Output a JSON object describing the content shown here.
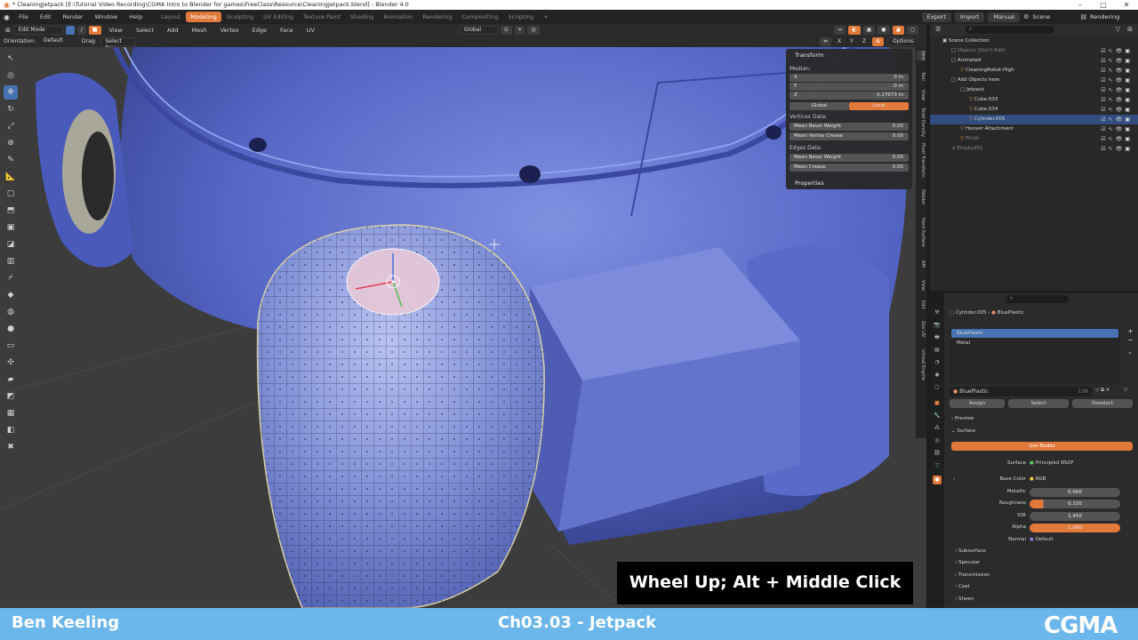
{
  "window": {
    "title": "* CleaningJetpack [E:\\Tutorial Video Recording\\CGMA Intro to Blender for games\\FreeClass\\Resource\\CleaningJetpack.blend] - Blender 4.0"
  },
  "menu": {
    "items": [
      "File",
      "Edit",
      "Render",
      "Window",
      "Help"
    ]
  },
  "workspaces": {
    "tabs": [
      "Layout",
      "Modeling",
      "Sculpting",
      "UV Editing",
      "Texture Paint",
      "Shading",
      "Animation",
      "Rendering",
      "Compositing",
      "Scripting"
    ],
    "active": "Modeling",
    "add": "+"
  },
  "topright": {
    "export": "Export",
    "import": "Import",
    "manual": "Manual",
    "scene": "Scene",
    "view_layer": "Rendering"
  },
  "viewport_header": {
    "mode": "Edit Mode",
    "menus": [
      "View",
      "Select",
      "Add",
      "Mesh",
      "Vertex",
      "Edge",
      "Face",
      "UV"
    ],
    "transform_orientation": "Global",
    "orientation_label": "Orientation:",
    "orientation_value": "Default",
    "drag_label": "Drag:",
    "drag_value": "Select Box",
    "axes": [
      "X",
      "Y",
      "Z"
    ],
    "options": "Options"
  },
  "npanel": {
    "title": "Transform",
    "median_label": "Median:",
    "x_label": "X",
    "x_value": "0 m",
    "y_label": "Y",
    "y_value": "-0 m",
    "z_label": "Z",
    "z_value": "0.17673 m",
    "global": "Global",
    "local": "Local",
    "vertices_data": "Vertices Data:",
    "mean_bevel_weight_label": "Mean Bevel Weight",
    "mean_bevel_weight_value": "0.00",
    "mean_vertex_crease_label": "Mean Vertex Crease",
    "mean_vertex_crease_value": "0.00",
    "edges_data": "Edges Data:",
    "edge_bevel_label": "Mean Bevel Weight",
    "edge_bevel_value": "0.00",
    "mean_crease_label": "Mean Crease",
    "mean_crease_value": "0.00",
    "properties": "Properties"
  },
  "side_tabs": [
    "Item",
    "Tool",
    "View",
    "Texel Density",
    "Pivot Transform",
    "Weldar",
    "Hard Surface",
    "AM",
    "View",
    "Edit",
    "Zen UV",
    "Unreal Engine"
  ],
  "outliner": {
    "root": "Scene Collection",
    "rows": [
      {
        "label": "Objects (Don't Edit)",
        "indent": 1,
        "dim": true,
        "selected": false
      },
      {
        "label": "Animated",
        "indent": 1,
        "dim": false,
        "selected": false
      },
      {
        "label": "CleaningRobot-High",
        "indent": 2,
        "dim": false,
        "selected": false
      },
      {
        "label": "Add Objects here",
        "indent": 1,
        "dim": false,
        "selected": false
      },
      {
        "label": "Jetpack",
        "indent": 2,
        "dim": false,
        "selected": false
      },
      {
        "label": "Cube.033",
        "indent": 3,
        "dim": false,
        "selected": false
      },
      {
        "label": "Cube.034",
        "indent": 3,
        "dim": false,
        "selected": false
      },
      {
        "label": "Cylinder.005",
        "indent": 3,
        "dim": false,
        "selected": true
      },
      {
        "label": "Hoover Attachment",
        "indent": 2,
        "dim": false,
        "selected": false
      },
      {
        "label": "Plinth",
        "indent": 2,
        "dim": true,
        "selected": false
      },
      {
        "label": "Empty.001",
        "indent": 1,
        "dim": true,
        "selected": false
      }
    ]
  },
  "properties": {
    "object": "Cylinder.005",
    "material": "BluePlastic",
    "slots": [
      "BluePlastic",
      "Metal"
    ],
    "material_field": "BluePlastic",
    "users": "108",
    "assign": "Assign",
    "select": "Select",
    "deselect": "Deselect",
    "preview": "Preview",
    "surface_section": "Surface",
    "use_nodes": "Use Nodes",
    "surface_label": "Surface",
    "surface_value": "Principled BSDF",
    "base_color_label": "Base Color",
    "base_color_value": "RGB",
    "metallic_label": "Metallic",
    "metallic_value": "0.000",
    "roughness_label": "Roughness",
    "roughness_value": "0.150",
    "ior_label": "IOR",
    "ior_value": "1.450",
    "alpha_label": "Alpha",
    "alpha_value": "1.000",
    "normal_label": "Normal",
    "normal_value": "Default",
    "sub_sections": [
      "Subsurface",
      "Specular",
      "Transmission",
      "Coat",
      "Sheen"
    ]
  },
  "overlay": {
    "presenter": "Ben Keeling",
    "chapter": "Ch03.03 - Jetpack",
    "logo": "CGMA",
    "caption": "Wheel Up; Alt + Middle Click"
  },
  "colors": {
    "accent": "#e0793a",
    "select_blue": "#4772b3",
    "bottom_bar": "#6bb6ea",
    "robot_blue": "#5a6bc8"
  }
}
